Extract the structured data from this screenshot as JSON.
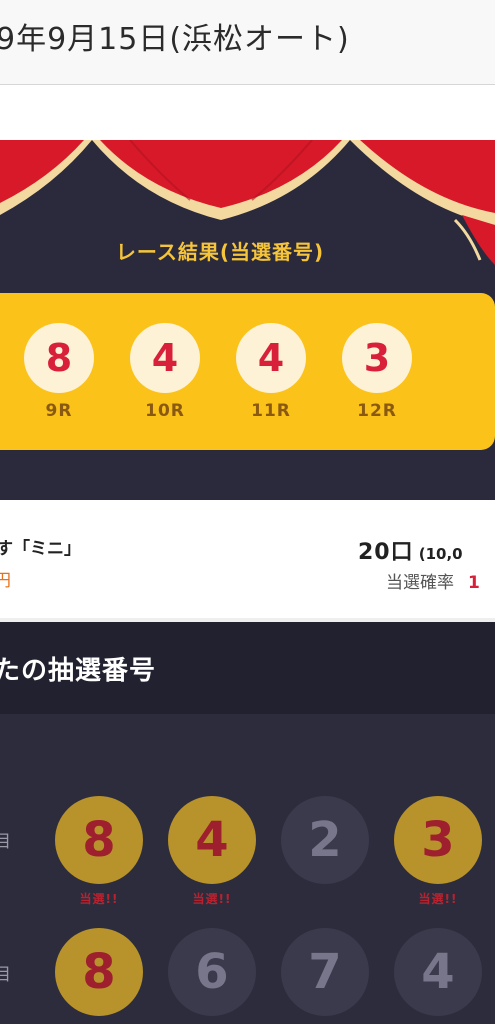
{
  "header": {
    "title": "9年9月15日(浜松オート)"
  },
  "result": {
    "title": "レース結果(当選番号)",
    "items": [
      {
        "number": "8",
        "race": "9R"
      },
      {
        "number": "4",
        "race": "10R"
      },
      {
        "number": "4",
        "race": "11R"
      },
      {
        "number": "3",
        "race": "12R"
      }
    ]
  },
  "info": {
    "product_name": "す「ミニ」",
    "product_sub": "円",
    "count_main": "20口",
    "count_sub": "(10,0",
    "probability_label": "当選確率",
    "probability_value": "1"
  },
  "picks": {
    "title": "たの抽選番号",
    "rows": [
      {
        "edge": "目",
        "balls": [
          {
            "number": "8",
            "hit": true,
            "mark": "当選!!"
          },
          {
            "number": "4",
            "hit": true,
            "mark": "当選!!"
          },
          {
            "number": "2",
            "hit": false,
            "mark": ""
          },
          {
            "number": "3",
            "hit": true,
            "mark": "当選!!"
          }
        ]
      },
      {
        "edge": "目",
        "balls": [
          {
            "number": "8",
            "hit": true,
            "mark": ""
          },
          {
            "number": "6",
            "hit": false,
            "mark": ""
          },
          {
            "number": "7",
            "hit": false,
            "mark": ""
          },
          {
            "number": "4",
            "hit": false,
            "mark": ""
          }
        ]
      }
    ]
  },
  "colors": {
    "curtain_red": "#d7192a",
    "curtain_trim": "#f3d9a0",
    "band_yellow": "#fbc21a",
    "stage_bg": "#2b2a3d",
    "hit_ball": "#b8922a",
    "miss_ball": "#3b3a4c"
  }
}
